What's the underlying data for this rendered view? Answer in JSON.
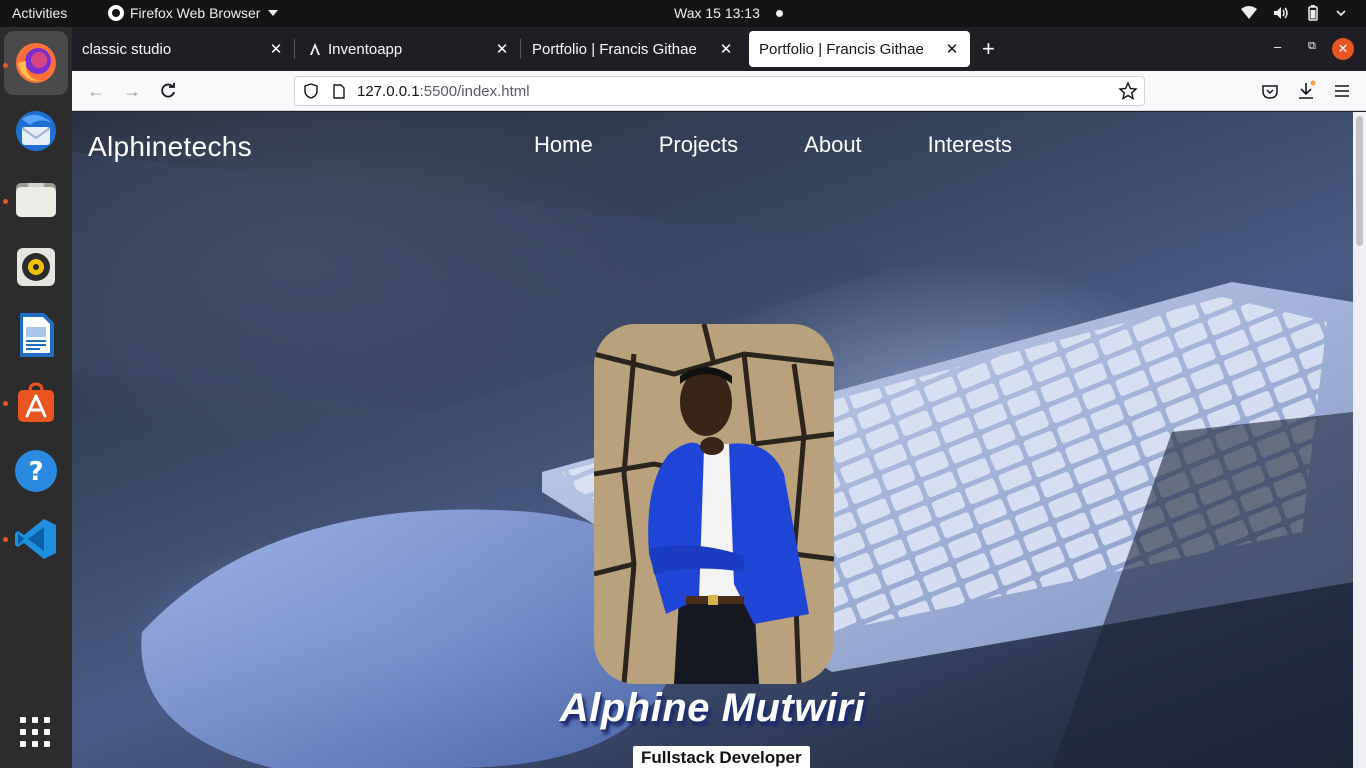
{
  "system": {
    "activities": "Activities",
    "app_menu": "Firefox Web Browser",
    "clock": "Wax 15  13:13"
  },
  "dock": {
    "apps": [
      "firefox-icon",
      "thunderbird-icon",
      "files-icon",
      "rhythmbox-icon",
      "writer-icon",
      "software-icon",
      "help-icon",
      "vscode-icon"
    ]
  },
  "browser": {
    "tabs": [
      {
        "label": "classic studio"
      },
      {
        "label": "Inventoapp"
      },
      {
        "label": "Portfolio | Francis Githae"
      },
      {
        "label": "Portfolio | Francis Githae"
      }
    ],
    "url_host": "127.0.0.1",
    "url_rest": ":5500/index.html"
  },
  "site": {
    "brand": "Alphinetechs",
    "nav": [
      "Home",
      "Projects",
      "About",
      "Interests"
    ],
    "name": "Alphine Mutwiri",
    "role": "Fullstack Developer"
  },
  "colors": {
    "accent": "#e95420",
    "hero_name_shadow": "#1c2c6e",
    "jacket_blue": "#1f45d6"
  }
}
